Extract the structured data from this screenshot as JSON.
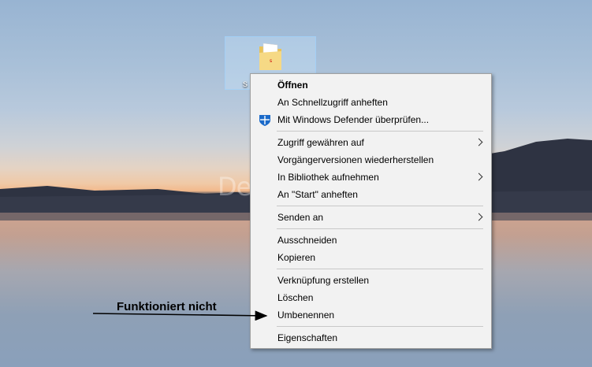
{
  "desktop": {
    "icon_label": "s",
    "watermark": "Deskmodder.de"
  },
  "context_menu": {
    "open": "Öffnen",
    "pin_quick_access": "An Schnellzugriff anheften",
    "defender_scan": "Mit Windows Defender überprüfen...",
    "grant_access": "Zugriff gewähren auf",
    "restore_previous": "Vorgängerversionen wiederherstellen",
    "include_library": "In Bibliothek aufnehmen",
    "pin_start": "An \"Start\" anheften",
    "send_to": "Senden an",
    "cut": "Ausschneiden",
    "copy": "Kopieren",
    "create_shortcut": "Verknüpfung erstellen",
    "delete": "Löschen",
    "rename": "Umbenennen",
    "properties": "Eigenschaften"
  },
  "annotation": {
    "text": "Funktioniert nicht"
  },
  "colors": {
    "menu_bg": "#f2f2f2",
    "defender_blue": "#1b6ac9"
  }
}
